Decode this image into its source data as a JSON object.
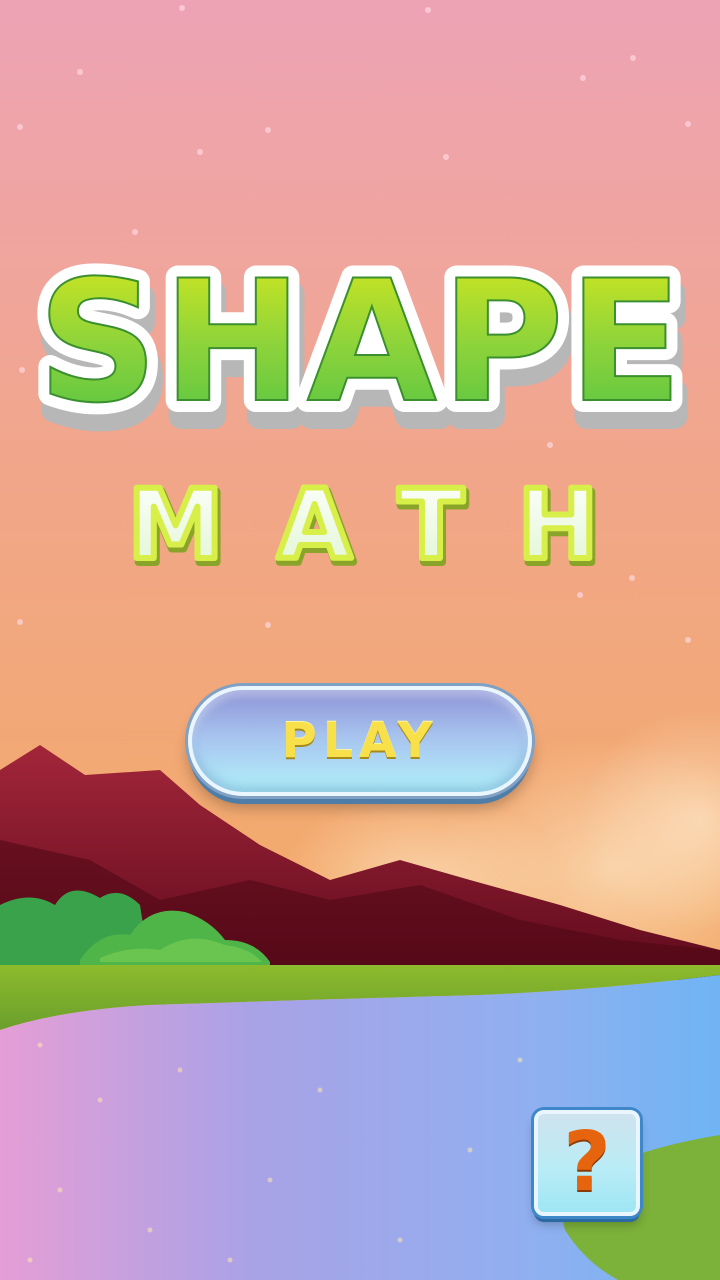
{
  "game": {
    "title_line1": "SHAPE",
    "title_line2": "MATH",
    "play_label": "PLAY",
    "help_label": "?"
  },
  "colors": {
    "sky_top": "#efa5b3",
    "sky_bottom": "#f3aa6a",
    "title_green": "#6ccf3a",
    "title_yellow": "#d8e820",
    "play_text": "#f7e04a",
    "help_text": "#e6640e",
    "mountain": "#8a1a2a",
    "grass": "#7fb535",
    "water": "#8fa3e4"
  },
  "icons": {
    "help": "question-mark-icon"
  }
}
